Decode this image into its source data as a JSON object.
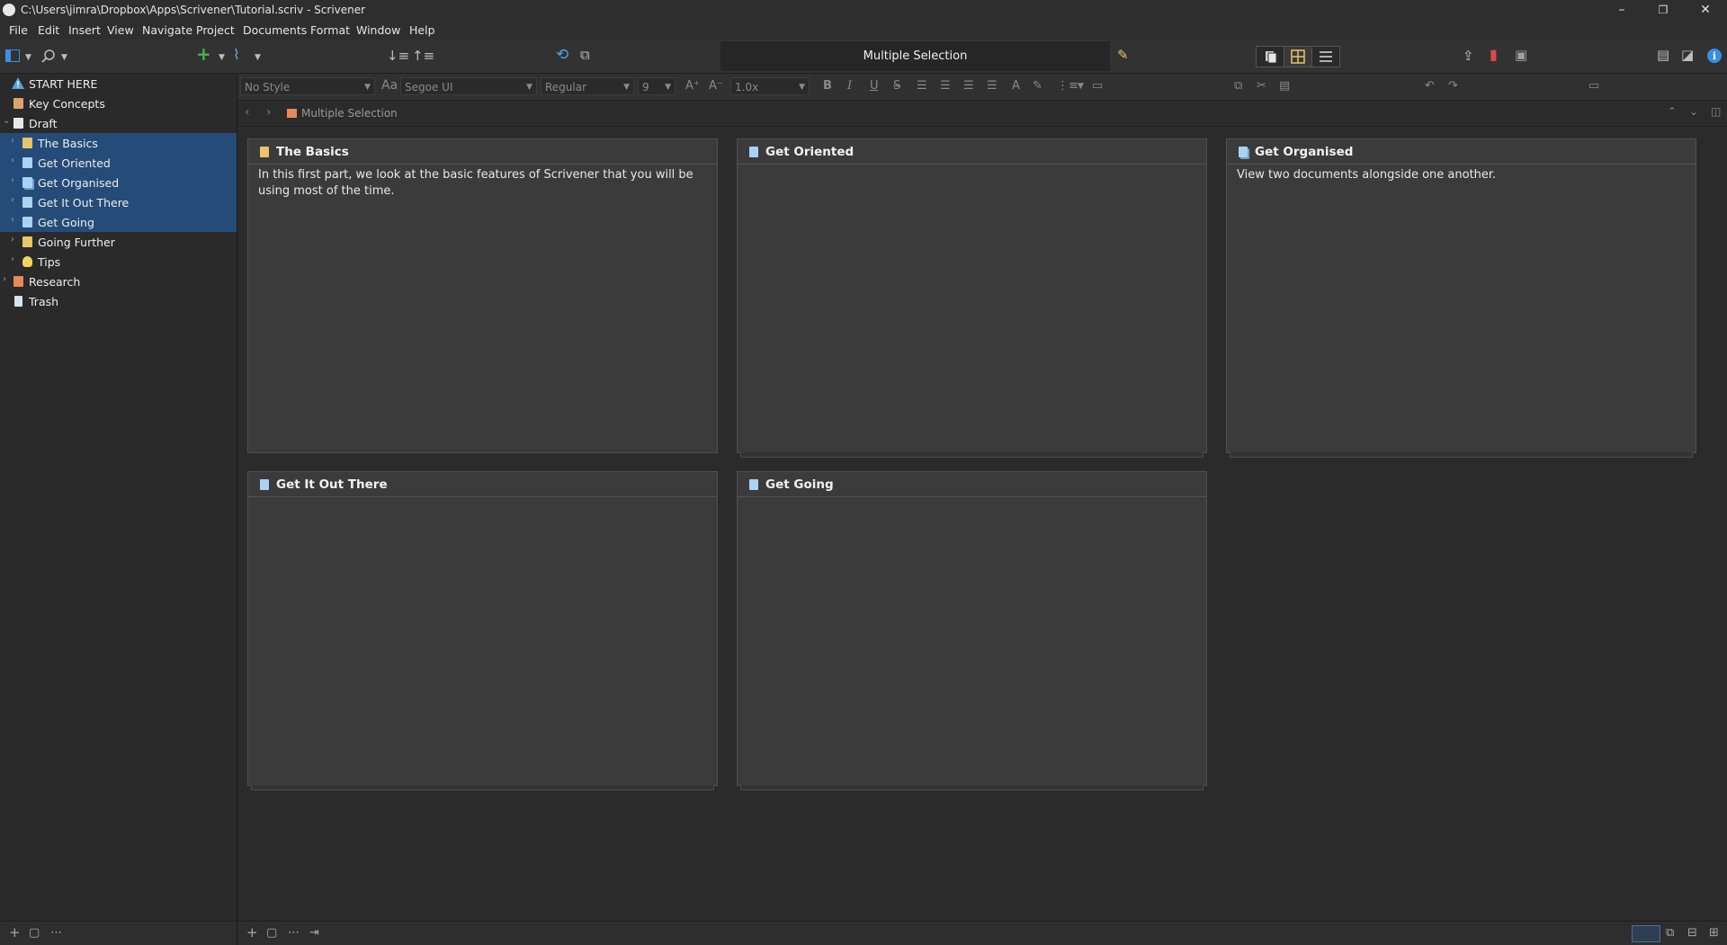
{
  "window": {
    "title": "C:\\Users\\jimra\\Dropbox\\Apps\\Scrivener\\Tutorial.scriv - Scrivener",
    "minimize": "–",
    "restore": "❐",
    "close": "✕"
  },
  "menu": [
    "File",
    "Edit",
    "Insert",
    "View",
    "Navigate",
    "Project",
    "Documents",
    "Format",
    "Window",
    "Help"
  ],
  "toolbar": {
    "selection_title": "Multiple Selection"
  },
  "format_bar": {
    "style": "No Style",
    "font_icon": "Aa",
    "font": "Segoe UI",
    "weight": "Regular",
    "size": "9",
    "line_spacing": "1.0x",
    "bold": "B",
    "italic": "I",
    "underline": "U",
    "strike": "S"
  },
  "binder": [
    {
      "label": "START HERE",
      "icon": "warning-icon",
      "color": "#4ea3e0",
      "indent": 0,
      "selected": false
    },
    {
      "label": "Key Concepts",
      "icon": "presentation-icon",
      "color": "#d9a46b",
      "indent": 0,
      "selected": false
    },
    {
      "label": "Draft",
      "icon": "draft-icon",
      "color": "#e8e8e8",
      "indent": 0,
      "selected": false
    },
    {
      "label": "The Basics",
      "icon": "folder-notebook-icon",
      "color": "#e9c46a",
      "indent": 1,
      "selected": true
    },
    {
      "label": "Get Oriented",
      "icon": "document-icon",
      "color": "#a9d3f5",
      "indent": 1,
      "selected": true
    },
    {
      "label": "Get Organised",
      "icon": "document-stack-icon",
      "color": "#a9d3f5",
      "indent": 1,
      "selected": true
    },
    {
      "label": "Get It Out There",
      "icon": "document-icon",
      "color": "#a9d3f5",
      "indent": 1,
      "selected": true
    },
    {
      "label": "Get Going",
      "icon": "document-icon",
      "color": "#a9d3f5",
      "indent": 1,
      "selected": true
    },
    {
      "label": "Going Further",
      "icon": "folder-notebook-icon",
      "color": "#e9c46a",
      "indent": 1,
      "selected": false
    },
    {
      "label": "Tips",
      "icon": "lightbulb-icon",
      "color": "#f3d35b",
      "indent": 1,
      "selected": false
    },
    {
      "label": "Research",
      "icon": "research-icon",
      "color": "#e58a5b",
      "indent": 0,
      "selected": false
    },
    {
      "label": "Trash",
      "icon": "trash-icon",
      "color": "#cfe6f7",
      "indent": 0,
      "selected": false
    }
  ],
  "breadcrumb": {
    "label": "Multiple Selection"
  },
  "corkboard": {
    "cards": [
      {
        "title": "The Basics",
        "synopsis": "In this first part, we look at the basic features of Scrivener that you will be using most of the time.",
        "icon": "folder-notebook-icon",
        "color": "#e9c46a",
        "stacked": false
      },
      {
        "title": "Get Oriented",
        "synopsis": "",
        "icon": "document-icon",
        "color": "#a9d3f5",
        "stacked": true
      },
      {
        "title": "Get Organised",
        "synopsis": "View two documents alongside one another.",
        "icon": "document-stack-icon",
        "color": "#a9d3f5",
        "stacked": true
      },
      {
        "title": "Get It Out There",
        "synopsis": "",
        "icon": "document-icon",
        "color": "#a9d3f5",
        "stacked": true
      },
      {
        "title": "Get Going",
        "synopsis": "",
        "icon": "document-icon",
        "color": "#a9d3f5",
        "stacked": true
      }
    ]
  },
  "colors": {
    "selection": "#254c78",
    "accent_blue": "#3a8ee6",
    "add_green": "#4caf50",
    "bookmark_red": "#e04848"
  }
}
